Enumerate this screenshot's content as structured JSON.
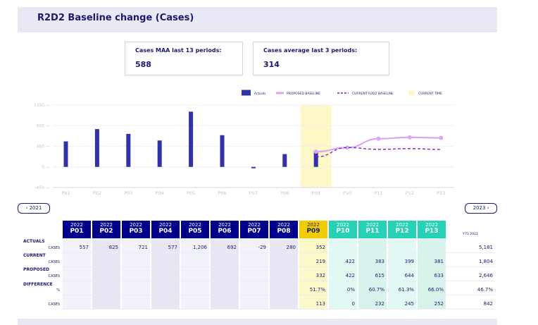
{
  "title": "R2D2 Baseline change (Cases)",
  "kpis": {
    "maa_label": "Cases MAA last 13 periods:",
    "maa_value": "588",
    "avg_label": "Cases average last 3 periods:",
    "avg_value": "314"
  },
  "nav": {
    "prev": "‹ 2021",
    "next": "2023 ›"
  },
  "chart_data": {
    "type": "bar",
    "categories": [
      "P01",
      "P02",
      "P03",
      "P04",
      "P05",
      "P06",
      "P07",
      "P08",
      "P09",
      "P10",
      "P11",
      "P12",
      "P13"
    ],
    "series": [
      {
        "name": "Actuals",
        "type": "bar",
        "values": [
          557,
          825,
          721,
          577,
          1206,
          692,
          -29,
          280,
          352,
          null,
          null,
          null,
          null
        ]
      },
      {
        "name": "PROPOSED BASELINE",
        "type": "line",
        "values": [
          null,
          null,
          null,
          null,
          null,
          null,
          null,
          null,
          332,
          422,
          615,
          644,
          633
        ]
      },
      {
        "name": "CURRENT R2D2 BASELINE",
        "type": "line-dashed",
        "values": [
          null,
          null,
          null,
          null,
          null,
          null,
          null,
          null,
          219,
          422,
          383,
          399,
          381
        ]
      }
    ],
    "legend": [
      "Actuals",
      "PROPOSED BASELINE",
      "CURRENT R2D2 BASELINE",
      "CURRENT TIME"
    ],
    "current_time_index": 8,
    "ylim": [
      -450,
      1350
    ],
    "yticks": [
      "1350 —",
      "900 —",
      "450 —",
      "0 —",
      "-450 —"
    ],
    "colors": {
      "actuals": "#3131a8",
      "proposed": "#d9a7f2",
      "current": "#7a22c7",
      "current_time": "#fdf8c8"
    },
    "legend_placement": "top-right",
    "grid": true
  },
  "table": {
    "year": "2022",
    "periods": [
      "P01",
      "P02",
      "P03",
      "P04",
      "P05",
      "P06",
      "P07",
      "P08",
      "P09",
      "P10",
      "P11",
      "P12",
      "P13"
    ],
    "row_labels": {
      "actuals": "ACTUALS",
      "current": "CURRENT",
      "proposed": "PROPOSED",
      "difference": "DIFFERENCE",
      "cases": "CASES",
      "pct": "%"
    },
    "ytd_header": "YTG 2022",
    "actuals": [
      "557",
      "825",
      "721",
      "577",
      "1,206",
      "692",
      "-29",
      "280",
      "352",
      "",
      "",
      "",
      ""
    ],
    "current": [
      "",
      "",
      "",
      "",
      "",
      "",
      "",
      "",
      "219",
      "422",
      "383",
      "399",
      "381"
    ],
    "proposed": [
      "",
      "",
      "",
      "",
      "",
      "",
      "",
      "",
      "332",
      "422",
      "615",
      "644",
      "633"
    ],
    "diff_pct": [
      "",
      "",
      "",
      "",
      "",
      "",
      "",
      "",
      "51.7%",
      "0%",
      "60.7%",
      "61.3%",
      "66.0%"
    ],
    "diff_cases": [
      "",
      "",
      "",
      "",
      "",
      "",
      "",
      "",
      "113",
      "0",
      "232",
      "245",
      "252"
    ],
    "ytd": {
      "actuals": "5,181",
      "current": "1,804",
      "proposed": "2,646",
      "diff_pct": "46.7%",
      "diff_cases": "842"
    },
    "colors": {
      "past_hdr": "#00008b",
      "current_hdr": "#f2cb00",
      "future_hdr": "#27d1b5",
      "past_bg": "#f2f2fa",
      "past_bg_alt": "#e7e7f3",
      "current_bg": "#fdf8c8",
      "future_bg": "#e2f8f3",
      "future_bg_alt": "#d6f4ec"
    }
  }
}
